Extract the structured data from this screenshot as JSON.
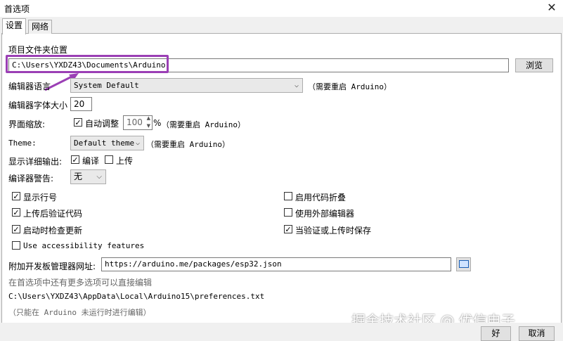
{
  "window": {
    "title": "首选项",
    "close_glyph": "✕"
  },
  "tabs": [
    {
      "label": "设置"
    },
    {
      "label": "网络"
    }
  ],
  "sketchbook": {
    "label": "项目文件夹位置",
    "value": "C:\\Users\\YXDZ43\\Documents\\Arduino",
    "browse_label": "浏览"
  },
  "editor_language": {
    "label": "编辑器语言",
    "value": "System Default",
    "note": "（需要重启 Arduino）"
  },
  "font_size": {
    "label": "编辑器字体大小",
    "value": "20"
  },
  "interface_scale": {
    "label": "界面缩放:",
    "auto_label": "自动调整",
    "auto_checked": true,
    "value": "100",
    "unit": "%",
    "note": "（需要重启 Arduino）"
  },
  "theme": {
    "label": "Theme:",
    "value": "Default theme",
    "note": "（需要重启 Arduino）"
  },
  "verbose": {
    "label": "显示详细输出:",
    "compile_label": "编译",
    "compile_checked": true,
    "upload_label": "上传",
    "upload_checked": false
  },
  "warnings": {
    "label": "编译器警告:",
    "value": "无"
  },
  "options_left": [
    {
      "label": "显示行号",
      "checked": true
    },
    {
      "label": "上传后验证代码",
      "checked": true
    },
    {
      "label": "启动时检查更新",
      "checked": true
    },
    {
      "label": "Use accessibility features",
      "checked": false
    }
  ],
  "options_right": [
    {
      "label": "启用代码折叠",
      "checked": false
    },
    {
      "label": "使用外部编辑器",
      "checked": false
    },
    {
      "label": "当验证或上传时保存",
      "checked": true
    }
  ],
  "boards_url": {
    "label": "附加开发板管理器网址:",
    "value": "https://arduino.me/packages/esp32.json"
  },
  "more_prefs": "在首选项中还有更多选项可以直接编辑",
  "prefs_path": "C:\\Users\\YXDZ43\\AppData\\Local\\Arduino15\\preferences.txt",
  "edit_note": "（只能在 Arduino 未运行时进行编辑）",
  "buttons": {
    "ok": "好",
    "cancel": "取消"
  },
  "watermark": "掘金技术社区 @ 优信电子",
  "colors": {
    "highlight": "#9b3fb5",
    "arrow": "#9b3fb5"
  }
}
